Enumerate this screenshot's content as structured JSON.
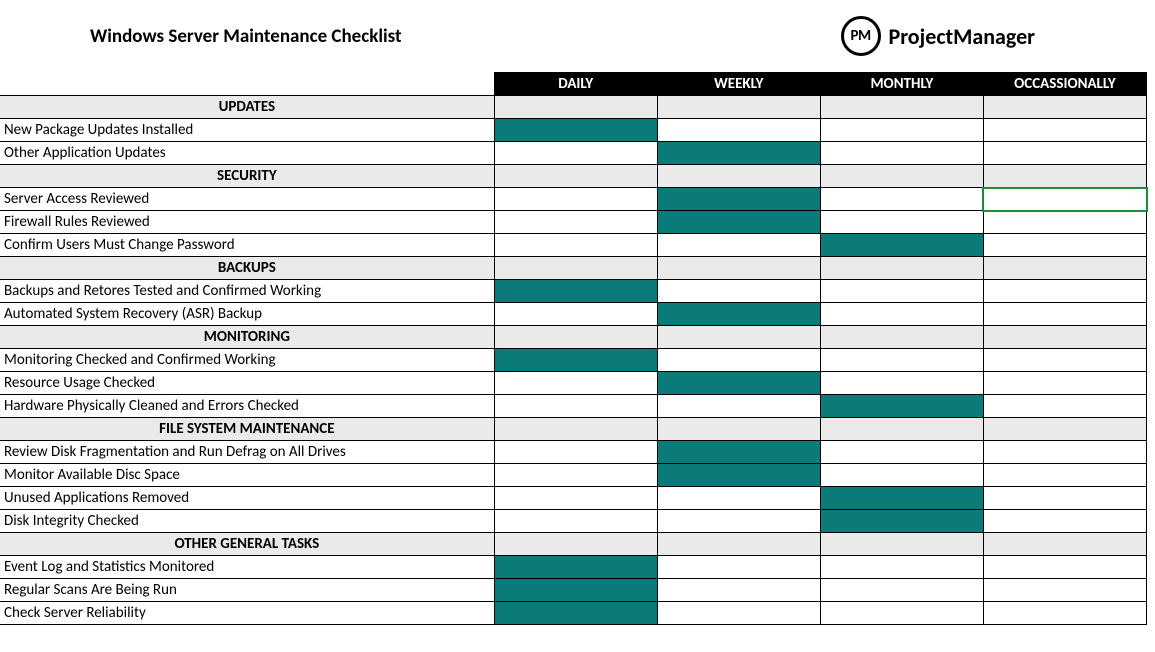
{
  "title": "Windows Server Maintenance Checklist",
  "brand": {
    "abbr": "PM",
    "name": "ProjectManager"
  },
  "columns": [
    "DAILY",
    "WEEKLY",
    "MONTHLY",
    "OCCASSIONALLY"
  ],
  "colors": {
    "fill": "#0b7b7a",
    "grey": "#eaeaea",
    "header_bg": "#000000",
    "header_fg": "#ffffff"
  },
  "rows": [
    {
      "type": "section",
      "label": "UPDATES"
    },
    {
      "type": "task",
      "label": "New Package Updates Installed",
      "freq": [
        true,
        false,
        false,
        false
      ]
    },
    {
      "type": "task",
      "label": "Other Application Updates",
      "freq": [
        false,
        true,
        false,
        false
      ]
    },
    {
      "type": "section",
      "label": "SECURITY"
    },
    {
      "type": "task",
      "label": "Server Access Reviewed",
      "freq": [
        false,
        true,
        false,
        false
      ],
      "selected": 3
    },
    {
      "type": "task",
      "label": "Firewall Rules Reviewed",
      "freq": [
        false,
        true,
        false,
        false
      ]
    },
    {
      "type": "task",
      "label": "Confirm Users Must Change Password",
      "freq": [
        false,
        false,
        true,
        false
      ]
    },
    {
      "type": "section",
      "label": "BACKUPS"
    },
    {
      "type": "task",
      "label": "Backups and Retores Tested and Confirmed Working",
      "freq": [
        true,
        false,
        false,
        false
      ]
    },
    {
      "type": "task",
      "label": "Automated System Recovery (ASR) Backup",
      "freq": [
        false,
        true,
        false,
        false
      ]
    },
    {
      "type": "section",
      "label": "MONITORING"
    },
    {
      "type": "task",
      "label": "Monitoring Checked and Confirmed Working",
      "freq": [
        true,
        false,
        false,
        false
      ]
    },
    {
      "type": "task",
      "label": "Resource Usage Checked",
      "freq": [
        false,
        true,
        false,
        false
      ]
    },
    {
      "type": "task",
      "label": "Hardware Physically Cleaned and Errors Checked",
      "freq": [
        false,
        false,
        true,
        false
      ]
    },
    {
      "type": "section",
      "label": "FILE SYSTEM MAINTENANCE"
    },
    {
      "type": "task",
      "label": "Review Disk Fragmentation and Run Defrag on All Drives",
      "freq": [
        false,
        true,
        false,
        false
      ]
    },
    {
      "type": "task",
      "label": "Monitor Available Disc Space",
      "freq": [
        false,
        true,
        false,
        false
      ]
    },
    {
      "type": "task",
      "label": "Unused Applications Removed",
      "freq": [
        false,
        false,
        true,
        false
      ]
    },
    {
      "type": "task",
      "label": "Disk Integrity Checked",
      "freq": [
        false,
        false,
        true,
        false
      ]
    },
    {
      "type": "section",
      "label": "OTHER GENERAL TASKS"
    },
    {
      "type": "task",
      "label": "Event Log and Statistics Monitored",
      "freq": [
        true,
        false,
        false,
        false
      ]
    },
    {
      "type": "task",
      "label": "Regular Scans Are Being Run",
      "freq": [
        true,
        false,
        false,
        false
      ]
    },
    {
      "type": "task",
      "label": "Check Server Reliability",
      "freq": [
        true,
        false,
        false,
        false
      ]
    }
  ]
}
